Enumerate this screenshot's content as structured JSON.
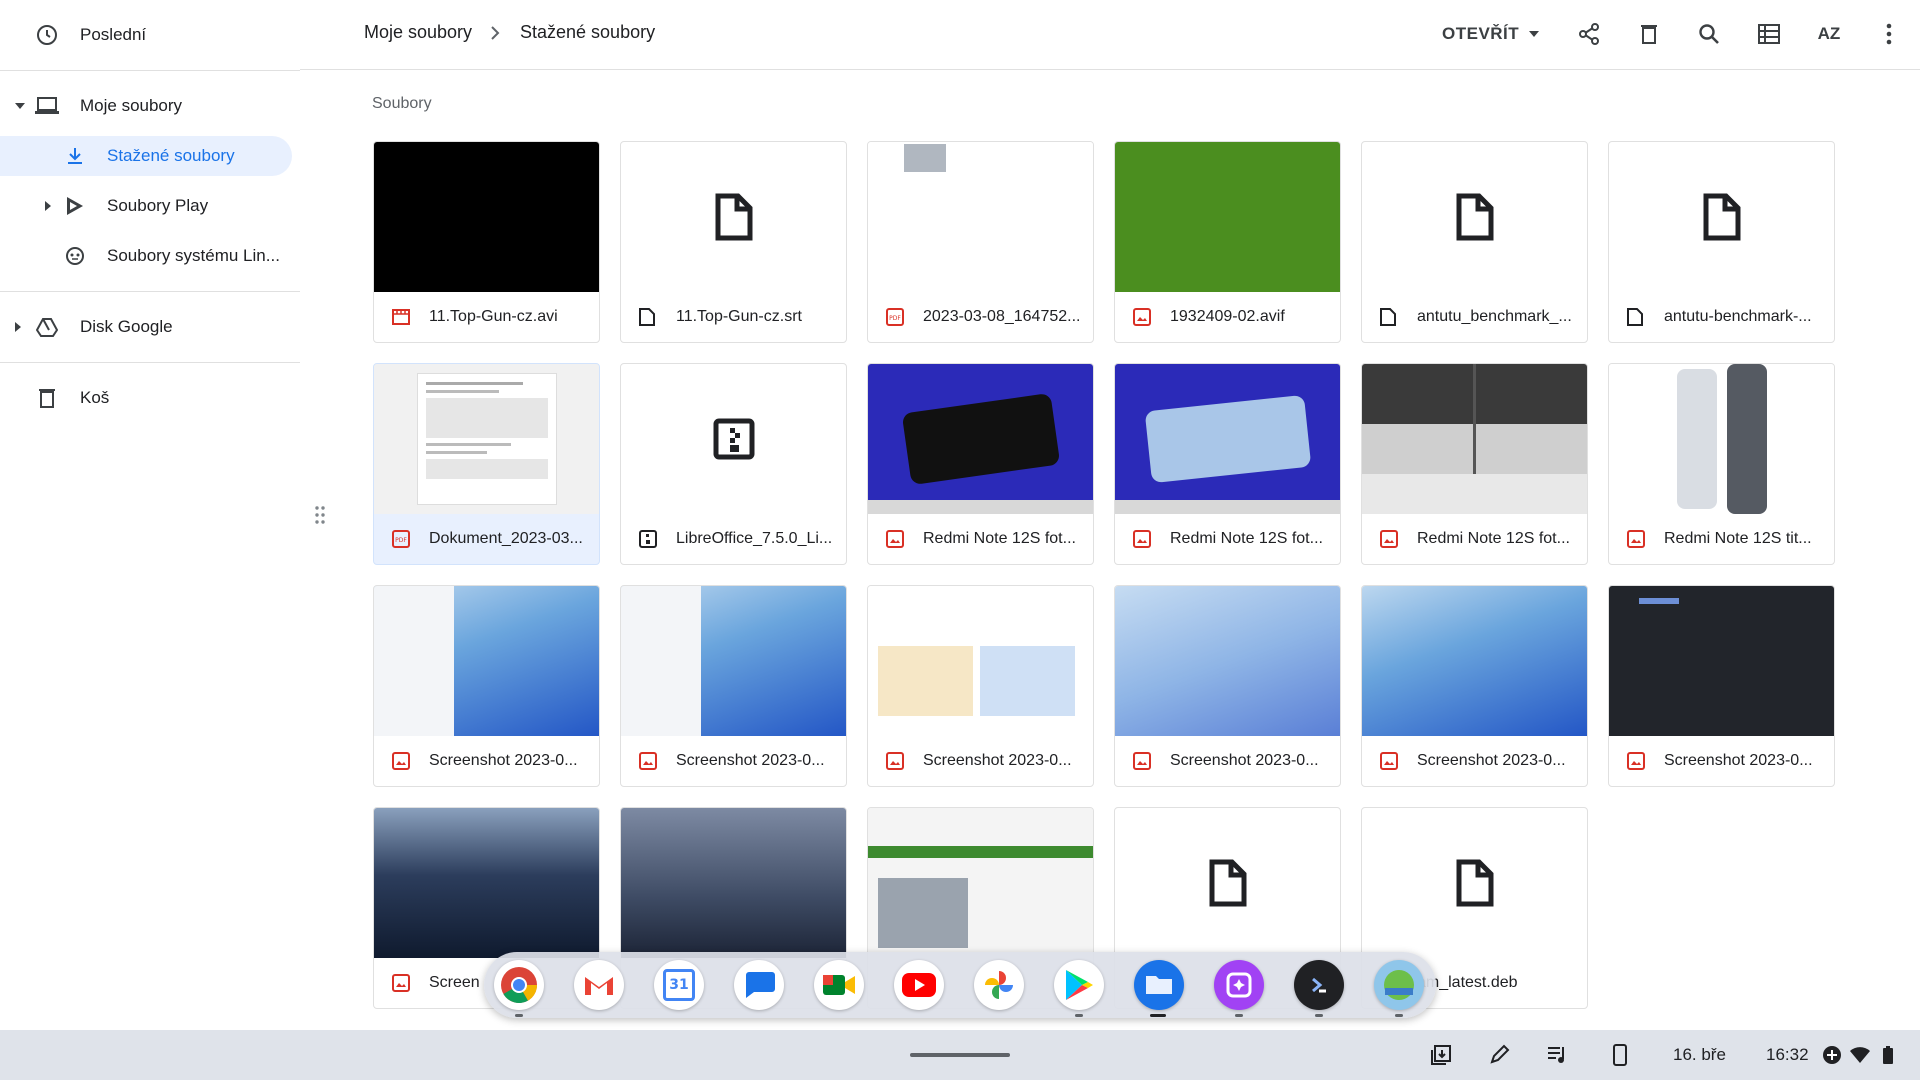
{
  "sidebar": {
    "recent": "Poslední",
    "my_files": "Moje soubory",
    "downloads": "Stažené soubory",
    "play_files": "Soubory Play",
    "linux_files": "Soubory systému Lin...",
    "google_drive": "Disk Google",
    "trash": "Koš"
  },
  "toolbar": {
    "breadcrumb": [
      "Moje soubory",
      "Stažené soubory"
    ],
    "open_label": "OTEVŘÍT",
    "sort_label": "AZ"
  },
  "section_label": "Soubory",
  "files": [
    {
      "name": "11.Top-Gun-cz.avi",
      "type": "video"
    },
    {
      "name": "11.Top-Gun-cz.srt",
      "type": "file"
    },
    {
      "name": "2023-03-08_164752...",
      "type": "pdf"
    },
    {
      "name": "1932409-02.avif",
      "type": "image"
    },
    {
      "name": "antutu_benchmark_...",
      "type": "file"
    },
    {
      "name": "antutu-benchmark-...",
      "type": "file"
    },
    {
      "name": "Dokument_2023-03...",
      "type": "pdf"
    },
    {
      "name": "LibreOffice_7.5.0_Li...",
      "type": "archive"
    },
    {
      "name": "Redmi Note 12S fot...",
      "type": "image"
    },
    {
      "name": "Redmi Note 12S fot...",
      "type": "image"
    },
    {
      "name": "Redmi Note 12S fot...",
      "type": "image"
    },
    {
      "name": "Redmi Note 12S tit...",
      "type": "image"
    },
    {
      "name": "Screenshot 2023-0...",
      "type": "image"
    },
    {
      "name": "Screenshot 2023-0...",
      "type": "image"
    },
    {
      "name": "Screenshot 2023-0...",
      "type": "image"
    },
    {
      "name": "Screenshot 2023-0...",
      "type": "image"
    },
    {
      "name": "Screenshot 2023-0...",
      "type": "image"
    },
    {
      "name": "Screenshot 2023-0...",
      "type": "image"
    },
    {
      "name": "Screen",
      "type": "image"
    },
    {
      "name": "",
      "type": "image"
    },
    {
      "name": "",
      "type": "image"
    },
    {
      "name": "",
      "type": "file"
    },
    {
      "name": "am_latest.deb",
      "type": "file"
    }
  ],
  "dock": {
    "apps": [
      "chrome",
      "gmail",
      "calendar",
      "messages",
      "meet",
      "youtube",
      "photos",
      "play-store",
      "files",
      "canvas",
      "terminal",
      "android-app"
    ],
    "calendar_day": "31"
  },
  "shelf": {
    "date": "16. bře",
    "time": "16:32"
  },
  "colors": {
    "accent": "#1a73e8",
    "active_bg": "#e8f0fe",
    "image_icon": "#d93025"
  }
}
